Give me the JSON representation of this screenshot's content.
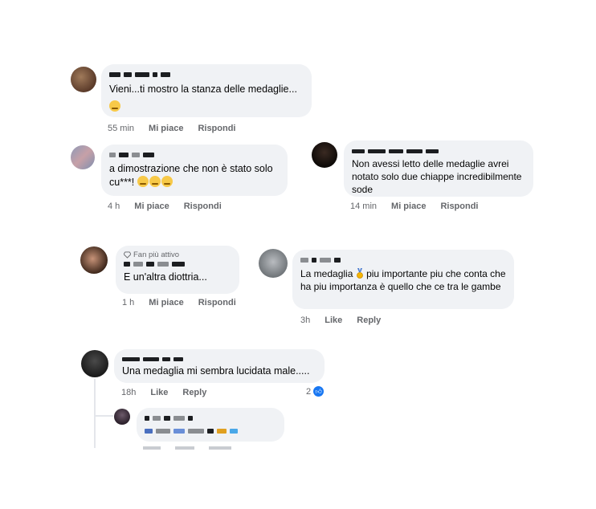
{
  "comments": [
    {
      "text": "Vieni...ti mostro la stanza delle medaglie...",
      "meta": {
        "time": "55 min",
        "like": "Mi piace",
        "reply": "Rispondi"
      }
    },
    {
      "text": "a dimostrazione che non è stato solo cu***!",
      "meta": {
        "time": "4 h",
        "like": "Mi piace",
        "reply": "Rispondi"
      }
    },
    {
      "text": "Non avessi letto delle medaglie avrei notato solo due chiappe incredibilmente sode",
      "meta": {
        "time": "14 min",
        "like": "Mi piace",
        "reply": "Rispondi"
      }
    },
    {
      "badge": "Fan più attivo",
      "text": "E un'altra diottria...",
      "meta": {
        "time": "1 h",
        "like": "Mi piace",
        "reply": "Rispondi"
      }
    },
    {
      "text_a": "La medaglia",
      "text_b": "piu importante piu che conta che ha piu importanza  è quello che ce tra le gambe",
      "meta": {
        "time": "3h",
        "like": "Like",
        "reply": "Reply"
      }
    },
    {
      "text": "Una medaglia mi sembra lucidata male.....",
      "meta": {
        "time": "18h",
        "like": "Like",
        "reply": "Reply"
      },
      "like_count": "2"
    }
  ],
  "icons": {
    "emoji": "smiley-icon",
    "medal": "medal-icon",
    "like": "thumbs-up-icon",
    "diamond": "diamond-icon"
  }
}
